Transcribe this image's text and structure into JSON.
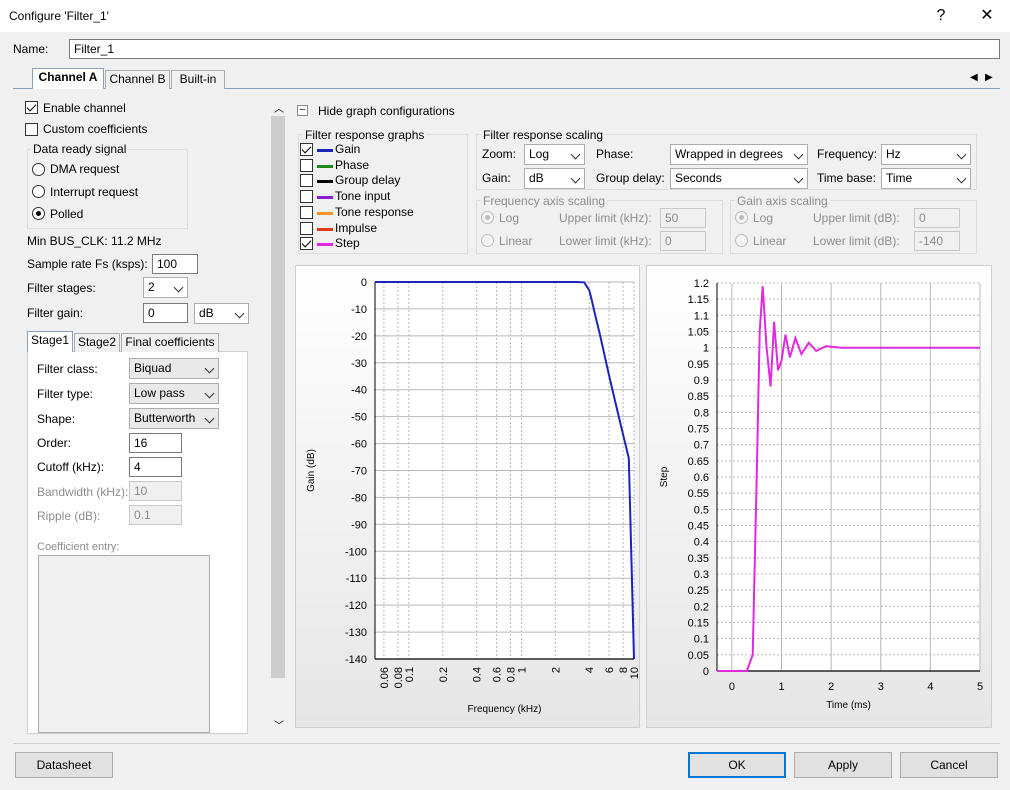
{
  "window": {
    "title": "Configure 'Filter_1'",
    "help": "?",
    "close": "✕"
  },
  "name_label": "Name:",
  "name_value": "Filter_1",
  "tabs": [
    "Channel A",
    "Channel B",
    "Built-in"
  ],
  "left": {
    "enable_channel": "Enable channel",
    "custom_coeffs": "Custom coefficients",
    "data_ready_title": "Data ready signal",
    "radios": [
      "DMA request",
      "Interrupt request",
      "Polled"
    ],
    "min_bus": "Min BUS_CLK: 11.2 MHz",
    "sample_rate_label": "Sample rate Fs (ksps):",
    "sample_rate_value": "100",
    "stages_label": "Filter stages:",
    "stages_value": "2",
    "gain_label": "Filter gain:",
    "gain_value": "0",
    "gain_unit": "dB",
    "stage_tabs": [
      "Stage1",
      "Stage2",
      "Final coefficients"
    ],
    "filter_class_label": "Filter class:",
    "filter_class": "Biquad",
    "filter_type_label": "Filter type:",
    "filter_type": "Low pass",
    "shape_label": "Shape:",
    "shape": "Butterworth",
    "order_label": "Order:",
    "order": "16",
    "cutoff_label": "Cutoff (kHz):",
    "cutoff": "4",
    "bandwidth_label": "Bandwidth (kHz):",
    "bandwidth": "10",
    "ripple_label": "Ripple (dB):",
    "ripple": "0.1",
    "coeff_label": "Coefficient entry:"
  },
  "right": {
    "hide_label": "Hide graph configurations",
    "hide_glyph": "–",
    "graphs_title": "Filter response graphs",
    "graphs": [
      {
        "name": "Gain",
        "checked": true,
        "color": "#1a24b8"
      },
      {
        "name": "Phase",
        "checked": false,
        "color": "#1a8a1a"
      },
      {
        "name": "Group delay",
        "checked": false,
        "color": "#000000"
      },
      {
        "name": "Tone input",
        "checked": false,
        "color": "#8b1ad0"
      },
      {
        "name": "Tone response",
        "checked": false,
        "color": "#f0962a"
      },
      {
        "name": "Impulse",
        "checked": false,
        "color": "#e03a1a"
      },
      {
        "name": "Step",
        "checked": true,
        "color": "#e02ae0"
      }
    ],
    "scaling_title": "Filter response scaling",
    "zoom_label": "Zoom:",
    "zoom": "Log",
    "phase_label": "Phase:",
    "phase": "Wrapped in degrees",
    "frequency_label": "Frequency:",
    "frequency": "Hz",
    "gain_label": "Gain:",
    "gain": "dB",
    "group_delay_label": "Group delay:",
    "group_delay": "Seconds",
    "time_base_label": "Time base:",
    "time_base": "Time",
    "freq_axis_title": "Frequency axis scaling",
    "freq_log": "Log",
    "freq_linear": "Linear",
    "upper_khz_label": "Upper limit (kHz):",
    "upper_khz": "50",
    "lower_khz_label": "Lower limit (kHz):",
    "lower_khz": "0",
    "gain_axis_title": "Gain axis scaling",
    "gain_log": "Log",
    "gain_linear": "Linear",
    "upper_db_label": "Upper limit (dB):",
    "upper_db": "0",
    "lower_db_label": "Lower limit (dB):",
    "lower_db": "-140"
  },
  "buttons": {
    "datasheet": "Datasheet",
    "ok": "OK",
    "apply": "Apply",
    "cancel": "Cancel"
  },
  "chart_data": [
    {
      "type": "line",
      "xlabel": "Frequency (kHz)",
      "ylabel": "Gain (dB)",
      "x_scale": "log",
      "xlim": [
        0.05,
        10
      ],
      "ylim": [
        -140,
        0
      ],
      "yticks": [
        0,
        -10,
        -20,
        -30,
        -40,
        -50,
        -60,
        -70,
        -80,
        -90,
        -100,
        -110,
        -120,
        -130,
        -140
      ],
      "xticks": [
        "0.06",
        "0.08",
        "0.1",
        "0.2",
        "0.4",
        "0.6",
        "0.8",
        "1",
        "2",
        "4",
        "6",
        "8",
        "10"
      ],
      "grid": true,
      "series": [
        {
          "color": "#1a24b8",
          "x": [
            0.05,
            1,
            2,
            3,
            3.6,
            4,
            4.2,
            4.5,
            5,
            6,
            7,
            8,
            9,
            10
          ],
          "y": [
            0,
            0,
            0,
            0,
            -0.1,
            -3,
            -6.5,
            -12,
            -19.8,
            -34.6,
            -46.6,
            -56.7,
            -65.4,
            -140
          ]
        }
      ]
    },
    {
      "type": "line",
      "xlabel": "Time (ms)",
      "ylabel": "Step",
      "xlim": [
        -0.3,
        5
      ],
      "ylim": [
        0,
        1.2
      ],
      "xticks": [
        0,
        1,
        2,
        3,
        4,
        5
      ],
      "yticks": [
        0,
        0.05,
        0.1,
        0.15,
        0.2,
        0.25,
        0.3,
        0.35,
        0.4,
        0.45,
        0.5,
        0.55,
        0.6,
        0.65,
        0.7,
        0.75,
        0.8,
        0.85,
        0.9,
        0.95,
        1,
        1.05,
        1.1,
        1.15,
        1.2
      ],
      "grid": true,
      "series": [
        {
          "color": "#e02ae0",
          "x": [
            -0.3,
            0.3,
            0.42,
            0.5,
            0.56,
            0.62,
            0.7,
            0.78,
            0.85,
            0.93,
            1.0,
            1.08,
            1.17,
            1.28,
            1.4,
            1.55,
            1.7,
            1.9,
            2.2,
            2.6,
            5
          ],
          "y": [
            0,
            0,
            0.05,
            0.6,
            1.05,
            1.19,
            1.0,
            0.88,
            1.08,
            0.93,
            0.96,
            1.04,
            0.97,
            1.03,
            0.98,
            1.015,
            0.99,
            1.005,
            1.0,
            1.0,
            1.0
          ]
        }
      ]
    }
  ]
}
